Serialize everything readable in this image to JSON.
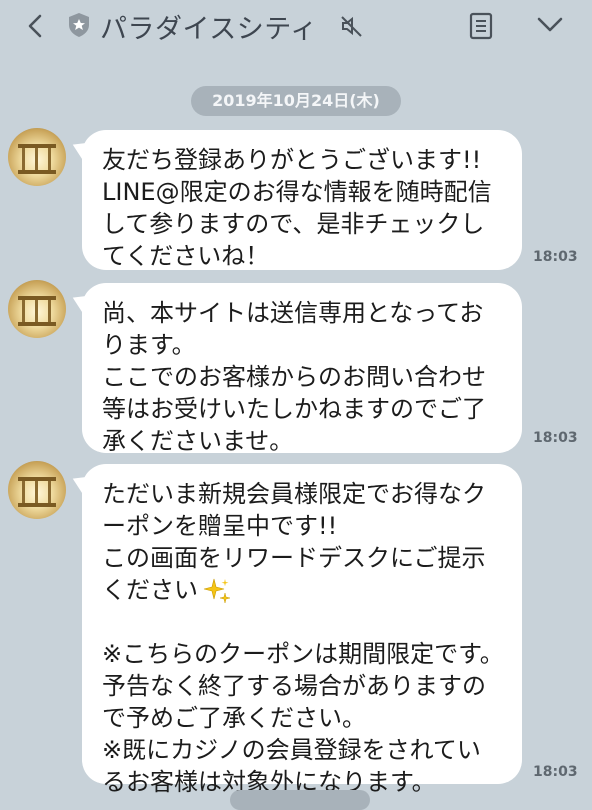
{
  "header": {
    "title": "パラダイスシティ",
    "back_icon": "chevron-left-icon",
    "account_badge_icon": "star-shield-icon",
    "mute_icon": "speaker-muted-icon",
    "notes_icon": "note-icon",
    "menu_icon": "chevron-down-icon"
  },
  "chat": {
    "date": "2019年10月24日(木)",
    "messages": [
      {
        "lines": [
          "友だち登録ありがとうございます!!",
          "LINE@限定のお得な情報を随時配信",
          "して参りますので、是非チェックし",
          "てくださいね！"
        ],
        "time": "18:03"
      },
      {
        "lines": [
          "尚、本サイトは送信専用となってお",
          "ります。",
          "ここでのお客様からのお問い合わせ",
          "等はお受けいたしかねますのでご了",
          "承くださいませ。"
        ],
        "time": "18:03"
      },
      {
        "lines": [
          "ただいま新規会員様限定でお得なク",
          "ーポンを贈呈中です!!",
          "この画面をリワードデスクにご提示",
          "ください",
          "",
          "※こちらのクーポンは期間限定です。",
          "予告なく終了する場合がありますの",
          "で予めご了承ください。",
          "※既にカジノの会員登録をされてい",
          "るお客様は対象外になります。"
        ],
        "time": "18:03",
        "emoji": "sparkles-icon"
      }
    ]
  }
}
